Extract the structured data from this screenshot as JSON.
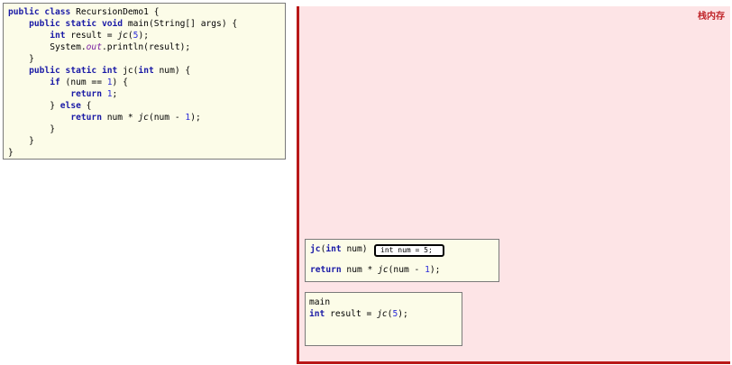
{
  "code": {
    "lines": [
      [
        {
          "t": "public class",
          "c": "kw"
        },
        {
          "t": " RecursionDemo1 {"
        }
      ],
      [
        {
          "t": "    "
        },
        {
          "t": "public static void",
          "c": "kw"
        },
        {
          "t": " main(String[] args) {"
        }
      ],
      [
        {
          "t": "        "
        },
        {
          "t": "int",
          "c": "kw"
        },
        {
          "t": " result = "
        },
        {
          "t": "jc",
          "c": "it"
        },
        {
          "t": "("
        },
        {
          "t": "5",
          "c": "num"
        },
        {
          "t": ");"
        }
      ],
      [
        {
          "t": "        System."
        },
        {
          "t": "out",
          "c": "fld"
        },
        {
          "t": ".println(result);"
        }
      ],
      [
        {
          "t": "    }"
        }
      ],
      [
        {
          "t": "    "
        },
        {
          "t": "public static int",
          "c": "kw"
        },
        {
          "t": " jc("
        },
        {
          "t": "int",
          "c": "kw"
        },
        {
          "t": " num) {"
        }
      ],
      [
        {
          "t": "        "
        },
        {
          "t": "if",
          "c": "kw"
        },
        {
          "t": " (num == "
        },
        {
          "t": "1",
          "c": "num"
        },
        {
          "t": ") {"
        }
      ],
      [
        {
          "t": "            "
        },
        {
          "t": "return",
          "c": "kw"
        },
        {
          "t": " "
        },
        {
          "t": "1",
          "c": "num"
        },
        {
          "t": ";"
        }
      ],
      [
        {
          "t": "        } "
        },
        {
          "t": "else",
          "c": "kw"
        },
        {
          "t": " {"
        }
      ],
      [
        {
          "t": "            "
        },
        {
          "t": "return",
          "c": "kw"
        },
        {
          "t": " num * "
        },
        {
          "t": "jc",
          "c": "it"
        },
        {
          "t": "(num - "
        },
        {
          "t": "1",
          "c": "num"
        },
        {
          "t": ");"
        }
      ],
      [
        {
          "t": "        }"
        }
      ],
      [
        {
          "t": "    }"
        }
      ],
      [
        {
          "t": "}"
        }
      ]
    ]
  },
  "stack": {
    "title": "栈内存",
    "frames": {
      "jc": {
        "header": [
          {
            "t": "jc",
            "c": "kw"
          },
          {
            "t": "("
          },
          {
            "t": "int",
            "c": "kw"
          },
          {
            "t": " num)"
          }
        ],
        "param": "int num = 5;",
        "body": [
          {
            "t": "return",
            "c": "kw"
          },
          {
            "t": " num * "
          },
          {
            "t": "jc",
            "c": "it"
          },
          {
            "t": "(num - "
          },
          {
            "t": "1",
            "c": "num"
          },
          {
            "t": ");"
          }
        ]
      },
      "main": {
        "header": [
          {
            "t": "main"
          }
        ],
        "body": [
          {
            "t": "int",
            "c": "kw"
          },
          {
            "t": " result = "
          },
          {
            "t": "jc",
            "c": "it"
          },
          {
            "t": "("
          },
          {
            "t": "5",
            "c": "num"
          },
          {
            "t": ");"
          }
        ]
      }
    }
  },
  "colors": {
    "keyword": "#1a1aa6",
    "number": "#2a2ad8",
    "stack_border": "#b81818",
    "stack_fill": "#fde4e6",
    "code_fill": "#fcfce8"
  }
}
